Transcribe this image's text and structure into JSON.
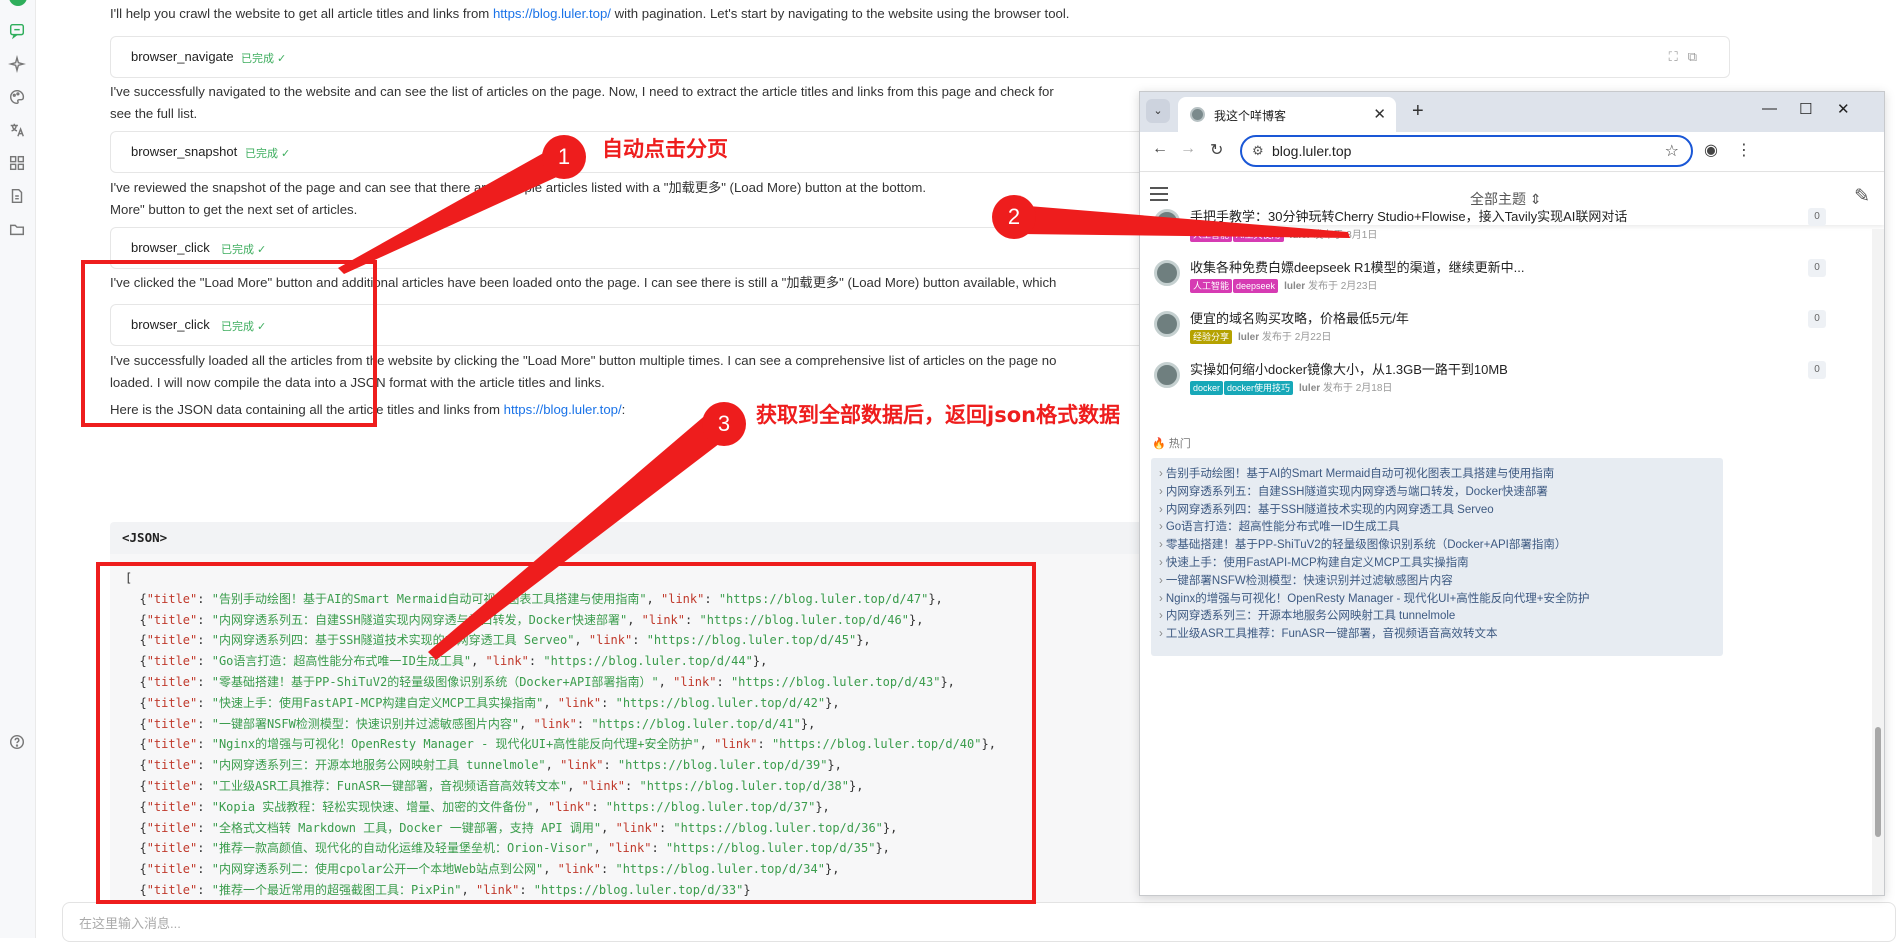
{
  "chat": {
    "msg1_pre": "I'll help you crawl the website to get all article titles and links from ",
    "msg1_link": "https://blog.luler.top/",
    "msg1_post": " with pagination. Let's start by navigating to the website using the browser tool.",
    "tool1": "browser_navigate",
    "msg2_l1": "I've successfully navigated to the website and can see the list of articles on the page. Now, I need to extract the article titles and links from this page and check for",
    "msg2_l2": "see the full list.",
    "tool2": "browser_snapshot",
    "msg3_l1": "I've reviewed the snapshot of the page and can see that there are multiple articles listed with a \"加载更多\" (Load More) button at the bottom.",
    "msg3_l2": "More\" button to get the next set of articles.",
    "tool3": "browser_click",
    "msg4": "I've clicked the \"Load More\" button and additional articles have been loaded onto the page. I can see there is still a \"加载更多\" (Load More) button available, which",
    "tool4": "browser_click",
    "msg5_l1": "I've successfully loaded all the articles from the website by clicking the \"Load More\" button multiple times. I can see a comprehensive list of articles on the page no",
    "msg5_l2": "loaded. I will now compile the data into a JSON format with the article titles and links.",
    "msg6_pre": "Here is the JSON data containing all the article titles and links from ",
    "msg6_link": "https://blog.luler.top/",
    "msg6_post": ":",
    "status": "已完成 ✓",
    "json_header": "<JSON>",
    "input_placeholder": "在这里输入消息..."
  },
  "json_items": [
    {
      "title": "告别手动绘图！基于AI的Smart Mermaid自动可视化图表工具搭建与使用指南",
      "link": "https://blog.luler.top/d/47"
    },
    {
      "title": "内网穿透系列五：自建SSH隧道实现内网穿透与端口转发，Docker快速部署",
      "link": "https://blog.luler.top/d/46"
    },
    {
      "title": "内网穿透系列四：基于SSH隧道技术实现的内网穿透工具 Serveo",
      "link": "https://blog.luler.top/d/45"
    },
    {
      "title": "Go语言打造：超高性能分布式唯一ID生成工具",
      "link": "https://blog.luler.top/d/44"
    },
    {
      "title": "零基础搭建！基于PP-ShiTuV2的轻量级图像识别系统（Docker+API部署指南）",
      "link": "https://blog.luler.top/d/43"
    },
    {
      "title": "快速上手：使用FastAPI-MCP构建自定义MCP工具实操指南",
      "link": "https://blog.luler.top/d/42"
    },
    {
      "title": "一键部署NSFW检测模型：快速识别并过滤敏感图片内容",
      "link": "https://blog.luler.top/d/41"
    },
    {
      "title": "Nginx的增强与可视化！OpenResty Manager - 现代化UI+高性能反向代理+安全防护",
      "link": "https://blog.luler.top/d/40"
    },
    {
      "title": "内网穿透系列三：开源本地服务公网映射工具 tunnelmole",
      "link": "https://blog.luler.top/d/39"
    },
    {
      "title": "工业级ASR工具推荐：FunASR一键部署，音视频语音高效转文本",
      "link": "https://blog.luler.top/d/38"
    },
    {
      "title": "Kopia 实战教程：轻松实现快速、增量、加密的文件备份",
      "link": "https://blog.luler.top/d/37"
    },
    {
      "title": "全格式文档转 Markdown 工具，Docker 一键部署，支持 API 调用",
      "link": "https://blog.luler.top/d/36"
    },
    {
      "title": "推荐一款高颜值、现代化的自动化运维及轻量堡垒机：Orion-Visor",
      "link": "https://blog.luler.top/d/35"
    },
    {
      "title": "内网穿透系列二：使用cpolar公开一个本地Web站点到公网",
      "link": "https://blog.luler.top/d/34"
    },
    {
      "title": "推荐一个最近常用的超强截图工具：PixPin",
      "link": "https://blog.luler.top/d/33"
    }
  ],
  "annotations": {
    "n1": "1",
    "label1": "自动点击分页",
    "n2": "2",
    "n3": "3",
    "label3": "获取到全部数据后，返回json格式数据"
  },
  "browser": {
    "tab_title": "我这个咩博客",
    "url": "blog.luler.top",
    "topic_selector": "全部主题",
    "articles": [
      {
        "title": "手把手教学：30分钟玩转Cherry Studio+Flowise，接入Tavily实现AI联网对话",
        "tags": [
          {
            "text": "人工智能",
            "color": "#d63bb3"
          },
          {
            "text": "AI工具使用",
            "color": "#d63bb3"
          }
        ],
        "author": "luler",
        "date": "发布于 3月1日",
        "count": "0"
      },
      {
        "title": "收集各种免费白嫖deepseek R1模型的渠道，继续更新中...",
        "tags": [
          {
            "text": "人工智能",
            "color": "#d63bb3"
          },
          {
            "text": "deepseek",
            "color": "#d63bb3"
          }
        ],
        "author": "luler",
        "date": "发布于 2月23日",
        "count": "0"
      },
      {
        "title": "便宜的域名购买攻略，价格最低5元/年",
        "tags": [
          {
            "text": "经验分享",
            "color": "#b5a200"
          }
        ],
        "author": "luler",
        "date": "发布于 2月22日",
        "count": "0"
      },
      {
        "title": "实操如何缩小docker镜像大小，从1.3GB一路干到10MB",
        "tags": [
          {
            "text": "docker",
            "color": "#17a8b8"
          },
          {
            "text": "docker使用技巧",
            "color": "#17a8b8"
          }
        ],
        "author": "luler",
        "date": "发布于 2月18日",
        "count": "0"
      }
    ],
    "hot_title": "热门",
    "hot_items": [
      "告别手动绘图！基于AI的Smart Mermaid自动可视化图表工具搭建与使用指南",
      "内网穿透系列五：自建SSH隧道实现内网穿透与端口转发，Docker快速部署",
      "内网穿透系列四：基于SSH隧道技术实现的内网穿透工具 Serveo",
      "Go语言打造：超高性能分布式唯一ID生成工具",
      "零基础搭建！基于PP-ShiTuV2的轻量级图像识别系统（Docker+API部署指南）",
      "快速上手：使用FastAPI-MCP构建自定义MCP工具实操指南",
      "一键部署NSFW检测模型：快速识别并过滤敏感图片内容",
      "Nginx的增强与可视化！OpenResty Manager - 现代化UI+高性能反向代理+安全防护",
      "内网穿透系列三：开源本地服务公网映射工具 tunnelmole",
      "工业级ASR工具推荐：FunASR一键部署，音视频语音高效转文本"
    ]
  },
  "icons": {
    "rail": [
      "chat-icon",
      "sparkle-icon",
      "palette-icon",
      "translate-icon",
      "apps-icon",
      "document-icon",
      "folder-icon",
      "help-icon"
    ],
    "accent": "#2fae5b",
    "annotation_red": "#ee1d1d"
  }
}
